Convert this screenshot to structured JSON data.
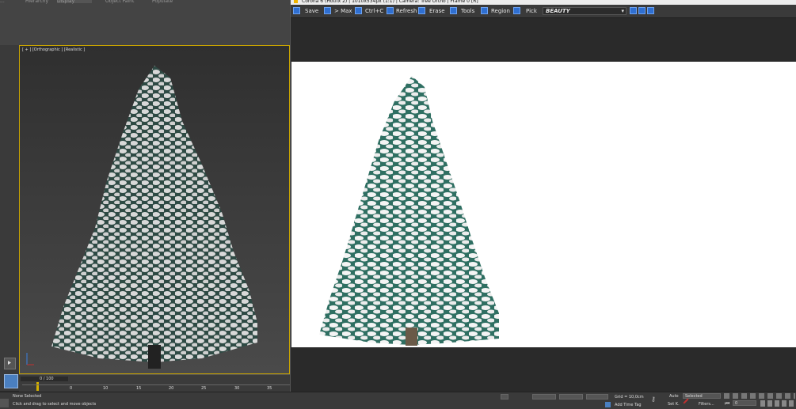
{
  "max": {
    "menu_tabs": [
      "...",
      "Hierarchy",
      "Display",
      "Object Paint",
      "Populate"
    ],
    "viewport_label": "[ + ] [Orthographic ] [Realistic ]",
    "time_slider": "0 / 100",
    "ruler_ticks": [
      "0",
      "10",
      "15",
      "20",
      "25",
      "30",
      "35"
    ],
    "status_selection": "None Selected",
    "status_prompt": "Click and drag to select and move objects",
    "grid_text": "Grid = 10,0cm",
    "add_time_tag": "Add Time Tag",
    "auto_label": "Auto",
    "selected_label": "Selected",
    "setk_label": "Set K.",
    "filters_label": "Filters...",
    "frame_value": "0"
  },
  "corona": {
    "title": "Corona 6 (Hotfix 2) | 1010x534px (1:1) | Camera: Tree Ortho | Frame 0 [R]",
    "toolbar": {
      "save": "Save",
      "to_max": "> Max",
      "copy": "Ctrl+C",
      "refresh": "Refresh",
      "erase": "Erase",
      "tools": "Tools",
      "region": "Region",
      "pick": "Pick",
      "pass": "BEAUTY"
    }
  },
  "colors": {
    "accent": "#2f6fd1",
    "viewport_border": "#c8a400",
    "render_bg": "#ffffff",
    "foliage": "#2f6f62",
    "snow": "#f2f2f2",
    "trunk": "#6a5a48"
  }
}
